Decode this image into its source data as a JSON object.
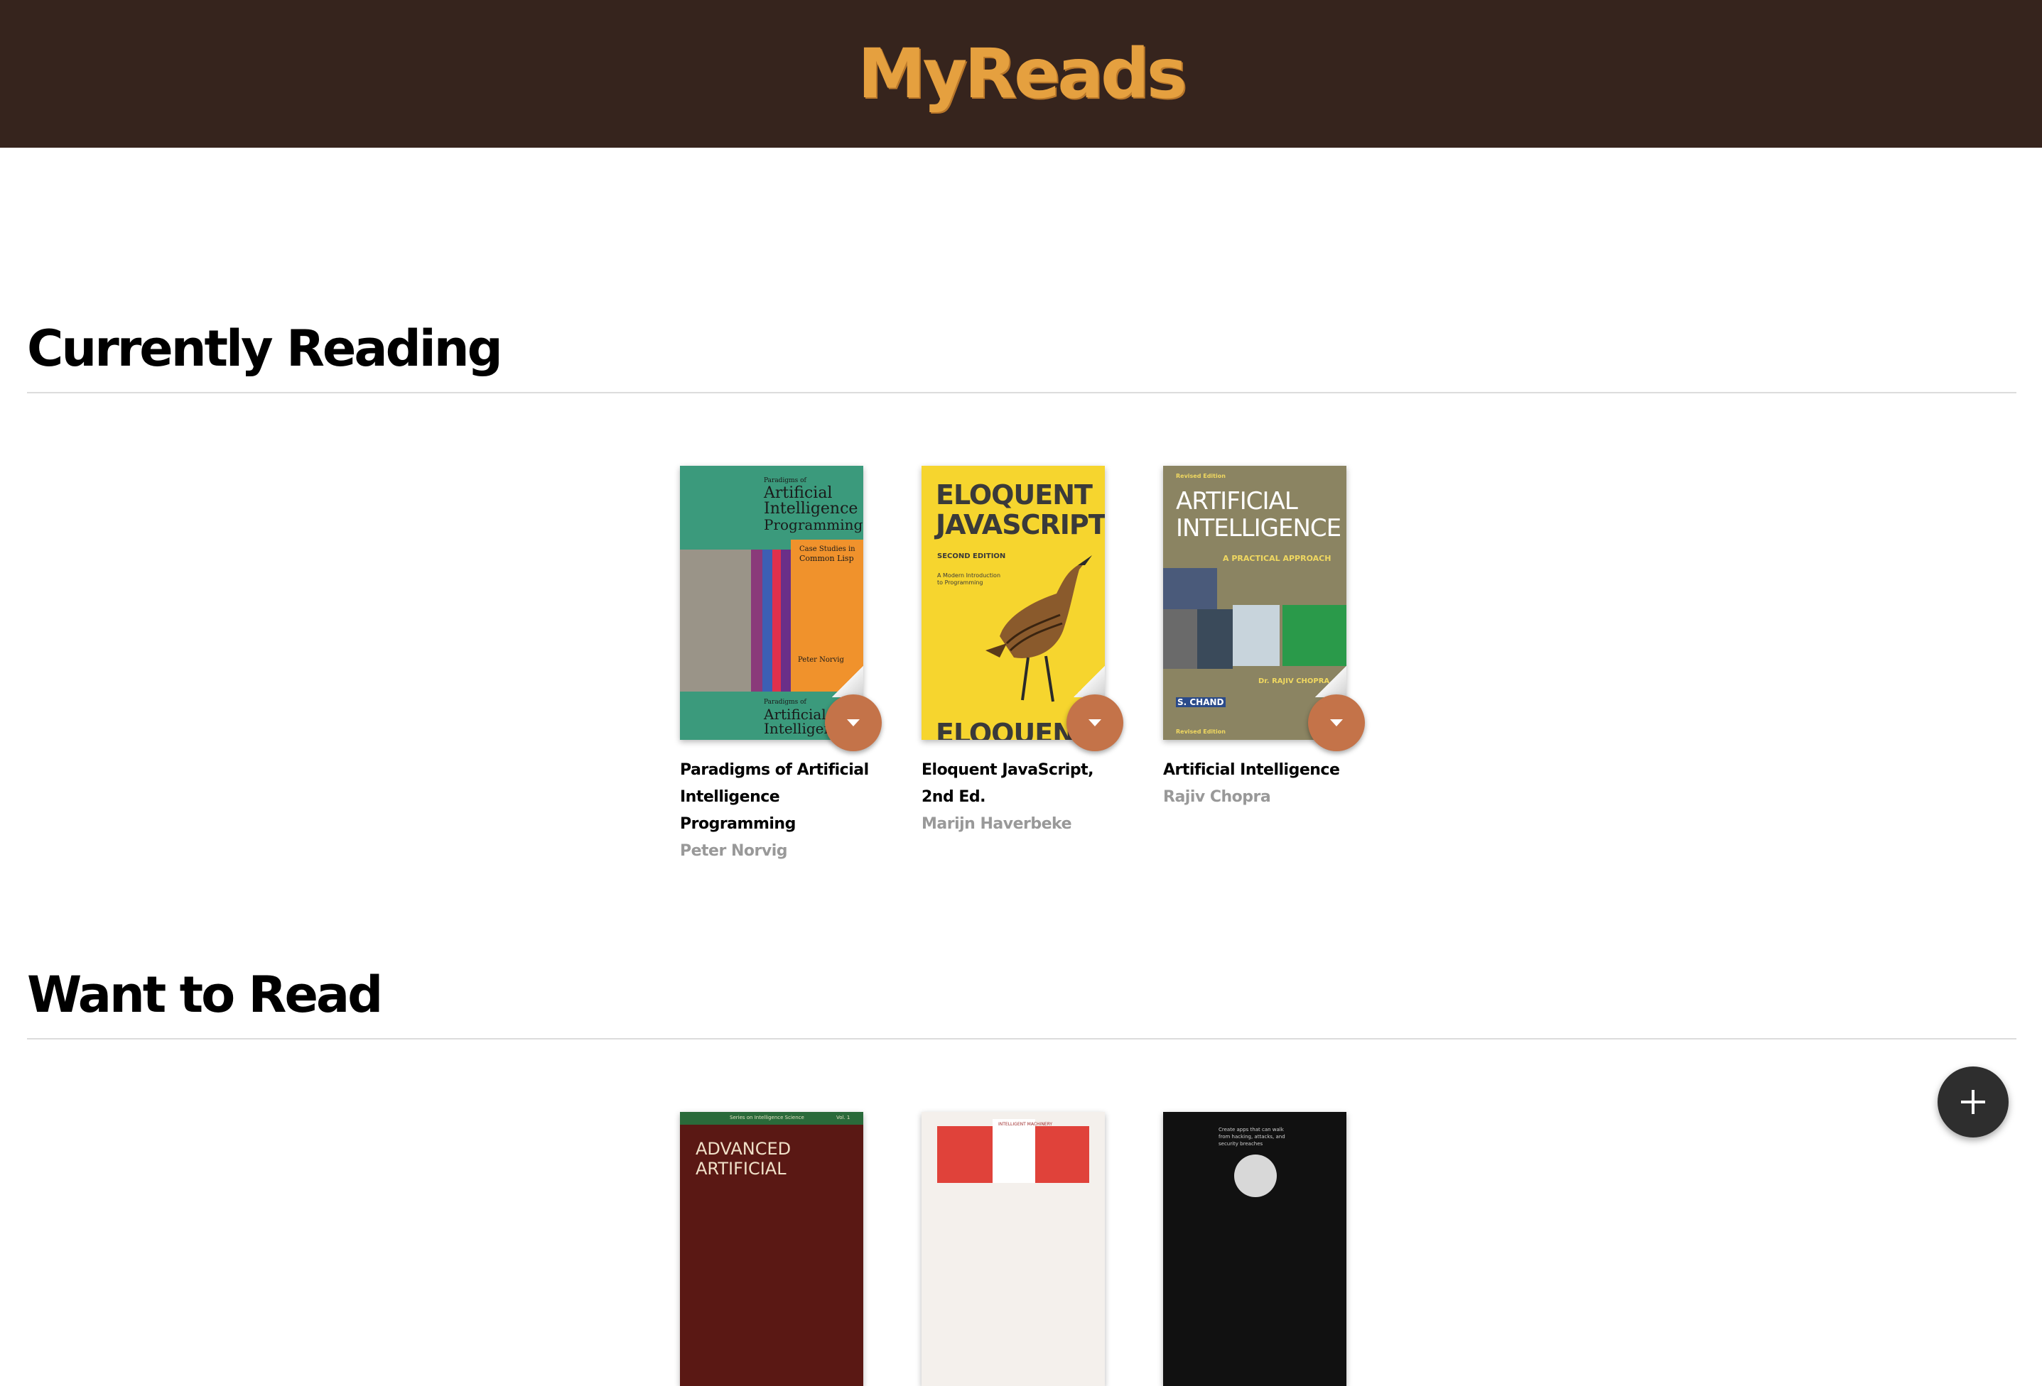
{
  "header": {
    "title": "MyReads"
  },
  "shelves": {
    "currently_reading": {
      "title": "Currently Reading",
      "books": [
        {
          "title": "Paradigms of Artificial Intelligence Programming",
          "author": "Peter Norvig",
          "cover": {
            "small": "Paradigms of",
            "line1": "Artificial",
            "line2": "Intelligence",
            "line3": "Programming:",
            "sub1": "Case Studies in",
            "sub2": "Common Lisp",
            "author": "Peter Norvig",
            "spine_small": "Paradigms of",
            "spine1": "Artificial",
            "spine2": "Intelligence"
          }
        },
        {
          "title": "Eloquent JavaScript, 2nd Ed.",
          "author": "Marijn Haverbeke",
          "cover": {
            "line1": "ELOQUENT",
            "line2": "JAVASCRIPT",
            "edition": "SECOND EDITION",
            "sub1": "A Modern Introduction",
            "sub2": "to Programming",
            "bottom": "ELOQUENT"
          }
        },
        {
          "title": "Artificial Intelligence",
          "author": "Rajiv Chopra",
          "cover": {
            "edition_top": "Revised Edition",
            "line1": "ARTIFICIAL",
            "line2": "INTELLIGENCE",
            "sub": "A PRACTICAL APPROACH",
            "author": "Dr. RAJIV CHOPRA",
            "publisher": "S. CHAND",
            "edition_bottom": "Revised Edition"
          }
        }
      ]
    },
    "want_to_read": {
      "title": "Want to Read",
      "books": [
        {
          "cover": {
            "top": "Series on Intelligence Science",
            "vol": "Vol. 1",
            "line1": "ADVANCED",
            "line2": "ARTIFICIAL"
          }
        },
        {
          "cover": {
            "top": "INTELLIGENT MACHINERY"
          }
        },
        {
          "cover": {
            "top": "Create apps that can walk from hacking, attacks, and security breaches"
          }
        }
      ]
    }
  },
  "fab": {
    "icon": "plus-icon"
  },
  "colors": {
    "header_bg": "#36241d",
    "title_color": "#e5a03f",
    "changer_bg": "#c47349",
    "fab_bg": "#2e2e2e"
  }
}
